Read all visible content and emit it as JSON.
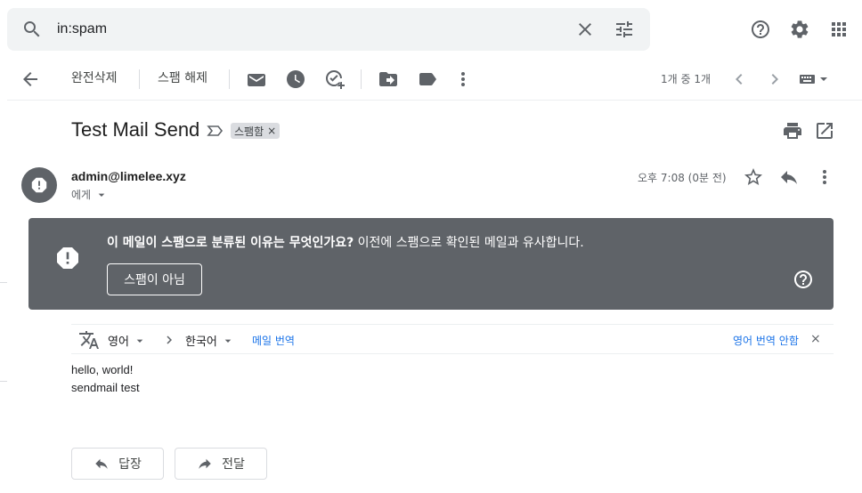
{
  "search": {
    "value": "in:spam",
    "icon": "search-icon"
  },
  "header_icons": [
    "help-icon",
    "gear-icon",
    "apps-icon"
  ],
  "toolbar": {
    "delete_forever": "완전삭제",
    "not_spam_label": "스팸 해제",
    "pager": "1개 중 1개"
  },
  "email": {
    "subject": "Test Mail Send",
    "label": "스팸함",
    "label_remove": "×",
    "sender": "admin@limelee.xyz",
    "to": "에게",
    "time": "오후 7:08 (0분 전)"
  },
  "spam_banner": {
    "question": "이 메일이 스팸으로 분류된 이유는 무엇인가요?",
    "reason": " 이전에 스팸으로 확인된 메일과 유사합니다.",
    "not_spam_button": "스팸이 아님",
    "background": "#5f6368"
  },
  "translate": {
    "source_lang": "영어",
    "target_lang": "한국어",
    "translate_link": "메일 번역",
    "dont_translate": "영어 번역 안함",
    "close": "×"
  },
  "body": {
    "line1": "hello, world!",
    "line2": "sendmail test"
  },
  "actions": {
    "reply": "답장",
    "forward": "전달"
  }
}
